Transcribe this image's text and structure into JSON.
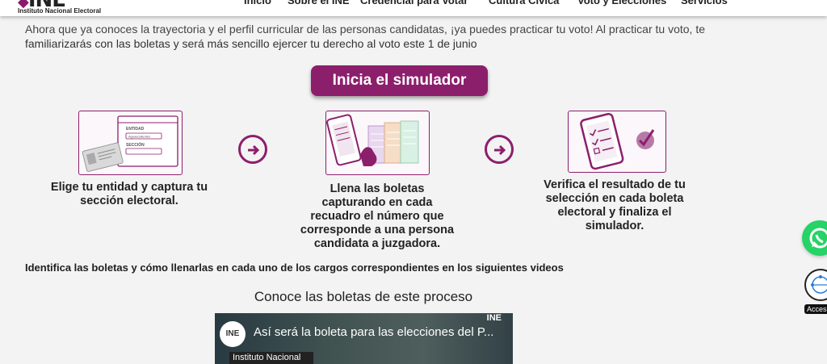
{
  "header": {
    "logo_text": "INE",
    "logo_subtitle": "Instituto Nacional Electoral",
    "nav": [
      "Inicio",
      "Sobre el INE",
      "Credencial para Votar",
      "Cultura Cívica",
      "Voto y Elecciones",
      "Servicios"
    ]
  },
  "intro": {
    "line1": "Ahora que ya conoces la trayectoria y el perfil curricular de las personas candidatas, ¡ya puedes practicar tu voto! Al practicar tu voto, te",
    "line2": "familiarizarás con las boletas y será más sencillo ejercer tu derecho al voto este 1 de junio"
  },
  "start_button": "Inicia el simulador",
  "steps": [
    {
      "lines": [
        "Elige tu entidad y captura tu",
        "sección electoral."
      ],
      "form_labels": [
        "ENTIDAD",
        "Aguascalientes",
        "SECCIÓN"
      ]
    },
    {
      "lines": [
        "Llena las boletas",
        "capturando en cada",
        "recuadro el número que",
        "corresponde a una persona",
        "candidata a juzgadora."
      ]
    },
    {
      "lines": [
        "Verifica el resultado de tu",
        "selección en cada boleta",
        "electoral y finaliza el",
        "simulador."
      ]
    }
  ],
  "videos_note": "Identifica las boletas y cómo llenarlas en cada uno de los cargos correspondientes en los siguientes videos",
  "section_title": "Conoce las boletas de este proceso",
  "video": {
    "title": "Así será la boleta para las elecciones del P...",
    "avatar_text": "INE",
    "channel": "Instituto Nacional",
    "logo": "INE"
  },
  "accessibility_label": "Accesib",
  "colors": {
    "brand": "#8c1f6c",
    "whatsapp": "#25d366"
  }
}
